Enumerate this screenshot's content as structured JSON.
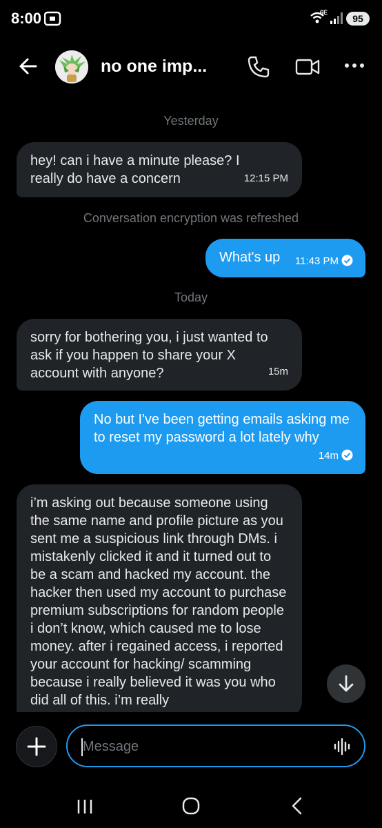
{
  "status_bar": {
    "time": "8:00",
    "network": "6E",
    "battery": "95"
  },
  "header": {
    "title": "no one imp..."
  },
  "messages": [
    {
      "type": "day",
      "text": "Yesterday"
    },
    {
      "type": "incoming",
      "text": "hey! can i have a minute please? I really do have a concern",
      "time": "12:15 PM"
    },
    {
      "type": "system",
      "text": "Conversation encryption was refreshed"
    },
    {
      "type": "outgoing",
      "text": "What's up",
      "time": "11:43 PM"
    },
    {
      "type": "day",
      "text": "Today"
    },
    {
      "type": "incoming",
      "text": "sorry for bothering you, i just wanted to ask if you happen to share your X account with anyone?",
      "time": "15m"
    },
    {
      "type": "outgoing",
      "text": "No but I've been getting emails asking me to reset my password a lot lately why",
      "time": "14m"
    },
    {
      "type": "incoming",
      "text": "i’m asking out because someone using the same name and profile picture as you sent me a suspicious link through DMs. i mistakenly clicked it and it turned out to be a scam and hacked my account. the hacker then used my account to purchase premium subscriptions for random people i don’t know, which caused me to lose money. after i regained access, i reported your account for hacking/ scamming because i really believed it was you who did all of this. i’m really"
    }
  ],
  "composer": {
    "placeholder": "Message"
  },
  "icons": {
    "back": "back-arrow-icon",
    "call": "phone-icon",
    "video": "video-camera-icon",
    "more": "more-icon",
    "add": "plus-icon",
    "voice": "voice-wave-icon",
    "scroll": "arrow-down-icon",
    "sent": "check-circle-icon"
  },
  "colors": {
    "accent": "#1d9bf0",
    "incoming_bubble": "#202327",
    "muted": "#71767b",
    "background": "#000000"
  }
}
